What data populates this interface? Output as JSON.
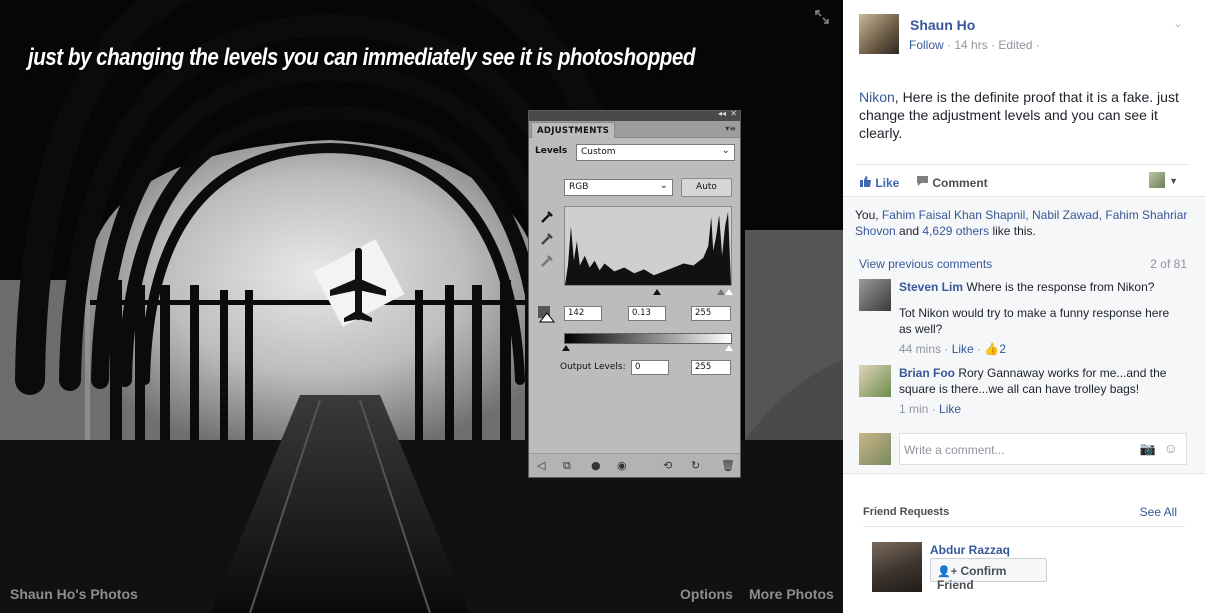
{
  "photo": {
    "caption": "just by changing the levels you can immediately see it is photoshopped",
    "footer_left": "Shaun Ho's Photos",
    "options_label": "Options",
    "more_photos_label": "More Photos"
  },
  "adjustments": {
    "tab_label": "ADJUSTMENTS",
    "levels_label": "Levels",
    "preset_value": "Custom",
    "channel_value": "RGB",
    "auto_label": "Auto",
    "input_black": "142",
    "input_gamma": "0.13",
    "input_white": "255",
    "output_levels_label": "Output Levels:",
    "output_black": "0",
    "output_white": "255"
  },
  "post": {
    "author": "Shaun Ho",
    "follow_label": "Follow",
    "time": "14 hrs",
    "edited": "Edited",
    "mention": "Nikon",
    "text": ", Here is the definite proof that it is a fake. just change the adjustment levels and you can see it clearly.",
    "like_label": "Like",
    "comment_label": "Comment"
  },
  "likes": {
    "you": "You, ",
    "names": "Fahim Faisal Khan Shapnil, Nabil Zawad, Fahim Shahriar Shovon",
    "and": " and ",
    "others": "4,629 others",
    "suffix": " like this."
  },
  "comments": {
    "view_previous": "View previous comments",
    "count": "2 of 81",
    "items": [
      {
        "name": "Steven Lim",
        "text1": " Where is the response from Nikon?",
        "text2": "Tot Nikon would try to make a funny response here as well?",
        "time": "44 mins",
        "like": "Like",
        "reactions": "2"
      },
      {
        "name": "Brian Foo",
        "text1": " Rory Gannaway works for me...and the square is there...we all can have trolley bags!",
        "time": "1 min",
        "like": "Like"
      }
    ],
    "write_placeholder": "Write a comment..."
  },
  "friend_requests": {
    "title": "Friend Requests",
    "see_all": "See All",
    "name": "Abdur Razzaq",
    "confirm_label": "Confirm Friend"
  },
  "colors": {
    "fb_link": "#365899",
    "fb_like": "#4267b2",
    "panel_bg": "#bcbcbc"
  }
}
